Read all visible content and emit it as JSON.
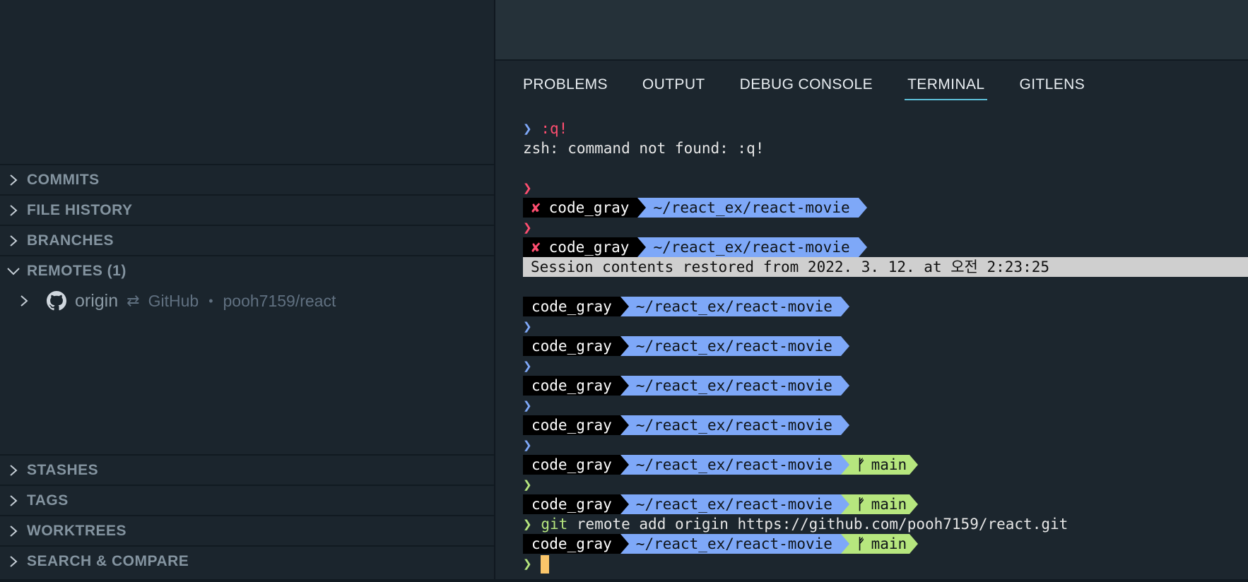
{
  "sidebar": {
    "sections_top": [
      {
        "label": "COMMITS",
        "expanded": false
      },
      {
        "label": "FILE HISTORY",
        "expanded": false
      },
      {
        "label": "BRANCHES",
        "expanded": false
      },
      {
        "label": "REMOTES (1)",
        "expanded": true
      }
    ],
    "remote": {
      "name": "origin",
      "arrows": "⇄",
      "provider": "GitHub",
      "separator": "•",
      "repo": "pooh7159/react",
      "icon": "github-icon"
    },
    "sections_bottom": [
      {
        "label": "STASHES",
        "expanded": false
      },
      {
        "label": "TAGS",
        "expanded": false
      },
      {
        "label": "WORKTREES",
        "expanded": false
      },
      {
        "label": "SEARCH & COMPARE",
        "expanded": false
      }
    ]
  },
  "panel": {
    "tabs": [
      "PROBLEMS",
      "OUTPUT",
      "DEBUG CONSOLE",
      "TERMINAL",
      "GITLENS"
    ],
    "active_tab": "TERMINAL"
  },
  "terminal": {
    "caret": "❯",
    "error_mark": "✘",
    "branch_icon": "ᚠ",
    "first_command": ":q!",
    "error_output": "zsh: command not found: :q!",
    "user": "code_gray",
    "path": "~/react_ex/react-movie",
    "branch": "main",
    "banner": "Session contents restored from 2022. 3. 12. at 오전 2:23:25",
    "git_cmd_word": "git",
    "git_cmd_rest": "remote add origin https://github.com/pooh7159/react.git"
  },
  "colors": {
    "accent_tab_underline": "#5ec0d8",
    "prompt_path_bg": "#7ea8f8",
    "prompt_git_bg": "#b6e67e",
    "error_red": "#ff4e70",
    "cursor": "#f9c56a"
  }
}
